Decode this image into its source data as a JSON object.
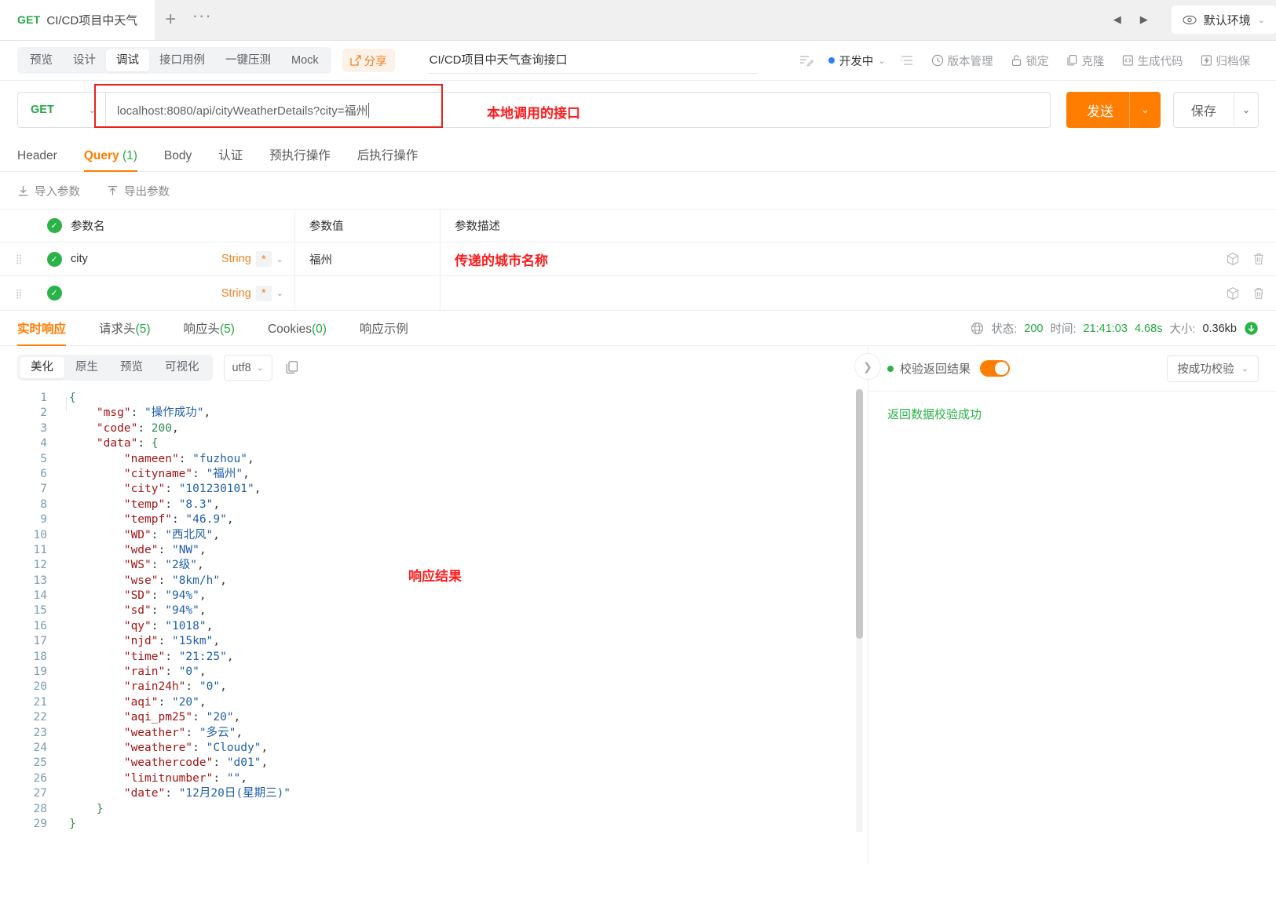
{
  "tabbar": {
    "tab": {
      "method": "GET",
      "name": "CI/CD项目中天气"
    },
    "add_label": "+",
    "more_label": "···",
    "prev_label": "◀",
    "next_label": "▶",
    "env": {
      "label": "默认环境",
      "icon": "eye-icon",
      "chevron": "⌄"
    }
  },
  "subbar": {
    "segments": [
      {
        "label": "预览",
        "active": false
      },
      {
        "label": "设计",
        "active": false
      },
      {
        "label": "调试",
        "active": true
      },
      {
        "label": "接口用例",
        "active": false
      },
      {
        "label": "一键压测",
        "active": false
      },
      {
        "label": "Mock",
        "active": false
      }
    ],
    "share_label": "分享",
    "api_title": "CI/CD项目中天气查询接口",
    "status_label": "开发中",
    "actions": [
      {
        "label": "版本管理",
        "icon": "clock-icon"
      },
      {
        "label": "锁定",
        "icon": "lock-icon"
      },
      {
        "label": "克隆",
        "icon": "copy-icon"
      },
      {
        "label": "生成代码",
        "icon": "code-icon"
      },
      {
        "label": "归档保",
        "icon": "archive-icon"
      }
    ]
  },
  "request": {
    "method": "GET",
    "url": "localhost:8080/api/cityWeatherDetails?city=福州",
    "url_annotation": "本地调用的接口",
    "send_label": "发送",
    "save_label": "保存"
  },
  "param_tabs": [
    {
      "label": "Header",
      "count": "",
      "active": false
    },
    {
      "label": "Query",
      "count": "(1)",
      "active": true
    },
    {
      "label": "Body",
      "count": "",
      "active": false
    },
    {
      "label": "认证",
      "count": "",
      "active": false
    },
    {
      "label": "预执行操作",
      "count": "",
      "active": false
    },
    {
      "label": "后执行操作",
      "count": "",
      "active": false
    }
  ],
  "io": {
    "import_label": "导入参数",
    "export_label": "导出参数"
  },
  "param_table": {
    "headers": {
      "name": "参数名",
      "value": "参数值",
      "desc": "参数描述"
    },
    "rows": [
      {
        "name": "city",
        "type": "String",
        "required": "*",
        "value": "福州",
        "desc": "传递的城市名称",
        "desc_is_annotation": true
      },
      {
        "name": "",
        "type": "String",
        "required": "*",
        "value": "",
        "desc": "",
        "desc_is_annotation": false
      }
    ]
  },
  "response_tabs": [
    {
      "label": "实时响应",
      "count": "",
      "active": true
    },
    {
      "label": "请求头",
      "count": "(5)",
      "active": false
    },
    {
      "label": "响应头",
      "count": "(5)",
      "active": false
    },
    {
      "label": "Cookies",
      "count": "(0)",
      "active": false
    },
    {
      "label": "响应示例",
      "count": "",
      "active": false
    }
  ],
  "response_meta": {
    "status_label": "状态:",
    "status_value": "200",
    "time_label": "时间:",
    "time_value": "21:41:03",
    "duration": "4.68s",
    "size_label": "大小:",
    "size_value": "0.36kb"
  },
  "format_bar": {
    "items": [
      {
        "label": "美化",
        "active": true
      },
      {
        "label": "原生",
        "active": false
      },
      {
        "label": "预览",
        "active": false
      },
      {
        "label": "可视化",
        "active": false
      }
    ],
    "encoding": "utf8",
    "copy_icon": "copy-icon"
  },
  "body_annotation": "响应结果",
  "response_body": {
    "lines": [
      {
        "n": 1,
        "indent": 0,
        "text": "{",
        "kind": "brace"
      },
      {
        "n": 2,
        "indent": 1,
        "key": "msg",
        "value": "\"操作成功\"",
        "vtype": "s",
        "comma": true
      },
      {
        "n": 3,
        "indent": 1,
        "key": "code",
        "value": "200",
        "vtype": "n",
        "comma": true
      },
      {
        "n": 4,
        "indent": 1,
        "key": "data",
        "value": "{",
        "vtype": "b",
        "comma": false
      },
      {
        "n": 5,
        "indent": 2,
        "key": "nameen",
        "value": "\"fuzhou\"",
        "vtype": "s",
        "comma": true
      },
      {
        "n": 6,
        "indent": 2,
        "key": "cityname",
        "value": "\"福州\"",
        "vtype": "s",
        "comma": true
      },
      {
        "n": 7,
        "indent": 2,
        "key": "city",
        "value": "\"101230101\"",
        "vtype": "s",
        "comma": true
      },
      {
        "n": 8,
        "indent": 2,
        "key": "temp",
        "value": "\"8.3\"",
        "vtype": "s",
        "comma": true
      },
      {
        "n": 9,
        "indent": 2,
        "key": "tempf",
        "value": "\"46.9\"",
        "vtype": "s",
        "comma": true
      },
      {
        "n": 10,
        "indent": 2,
        "key": "WD",
        "value": "\"西北风\"",
        "vtype": "s",
        "comma": true
      },
      {
        "n": 11,
        "indent": 2,
        "key": "wde",
        "value": "\"NW\"",
        "vtype": "s",
        "comma": true
      },
      {
        "n": 12,
        "indent": 2,
        "key": "WS",
        "value": "\"2级\"",
        "vtype": "s",
        "comma": true
      },
      {
        "n": 13,
        "indent": 2,
        "key": "wse",
        "value": "\"8km/h\"",
        "vtype": "s",
        "comma": true
      },
      {
        "n": 14,
        "indent": 2,
        "key": "SD",
        "value": "\"94%\"",
        "vtype": "s",
        "comma": true
      },
      {
        "n": 15,
        "indent": 2,
        "key": "sd",
        "value": "\"94%\"",
        "vtype": "s",
        "comma": true
      },
      {
        "n": 16,
        "indent": 2,
        "key": "qy",
        "value": "\"1018\"",
        "vtype": "s",
        "comma": true
      },
      {
        "n": 17,
        "indent": 2,
        "key": "njd",
        "value": "\"15km\"",
        "vtype": "s",
        "comma": true
      },
      {
        "n": 18,
        "indent": 2,
        "key": "time",
        "value": "\"21:25\"",
        "vtype": "s",
        "comma": true
      },
      {
        "n": 19,
        "indent": 2,
        "key": "rain",
        "value": "\"0\"",
        "vtype": "s",
        "comma": true
      },
      {
        "n": 20,
        "indent": 2,
        "key": "rain24h",
        "value": "\"0\"",
        "vtype": "s",
        "comma": true
      },
      {
        "n": 21,
        "indent": 2,
        "key": "aqi",
        "value": "\"20\"",
        "vtype": "s",
        "comma": true
      },
      {
        "n": 22,
        "indent": 2,
        "key": "aqi_pm25",
        "value": "\"20\"",
        "vtype": "s",
        "comma": true
      },
      {
        "n": 23,
        "indent": 2,
        "key": "weather",
        "value": "\"多云\"",
        "vtype": "s",
        "comma": true
      },
      {
        "n": 24,
        "indent": 2,
        "key": "weathere",
        "value": "\"Cloudy\"",
        "vtype": "s",
        "comma": true
      },
      {
        "n": 25,
        "indent": 2,
        "key": "weathercode",
        "value": "\"d01\"",
        "vtype": "s",
        "comma": true
      },
      {
        "n": 26,
        "indent": 2,
        "key": "limitnumber",
        "value": "\"\"",
        "vtype": "s",
        "comma": true
      },
      {
        "n": 27,
        "indent": 2,
        "key": "date",
        "value": "\"12月20日(星期三)\"",
        "vtype": "s",
        "comma": false
      },
      {
        "n": 28,
        "indent": 1,
        "text": "}",
        "kind": "brace"
      },
      {
        "n": 29,
        "indent": 0,
        "text": "}",
        "kind": "brace"
      }
    ]
  },
  "verify": {
    "title": "校验返回结果",
    "toggle_on": true,
    "mode": "按成功校验",
    "message": "返回数据校验成功"
  },
  "colors": {
    "accent": "#ff7d00",
    "success": "#2bb34a",
    "annotation_red": "#ff1a1a",
    "json_key": "#a31515",
    "json_string": "#1f5fa9",
    "json_number": "#2e8b57"
  }
}
